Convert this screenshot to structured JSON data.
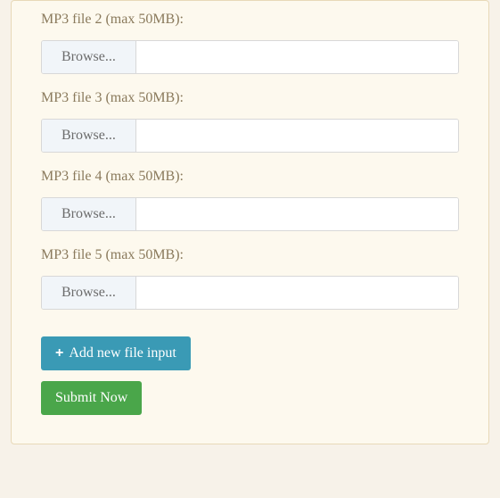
{
  "files": [
    {
      "label": "MP3 file 2 (max 50MB):",
      "browse": "Browse...",
      "value": ""
    },
    {
      "label": "MP3 file 3 (max 50MB):",
      "browse": "Browse...",
      "value": ""
    },
    {
      "label": "MP3 file 4 (max 50MB):",
      "browse": "Browse...",
      "value": ""
    },
    {
      "label": "MP3 file 5 (max 50MB):",
      "browse": "Browse...",
      "value": ""
    }
  ],
  "actions": {
    "add_label": "Add new file input",
    "submit_label": "Submit Now"
  }
}
